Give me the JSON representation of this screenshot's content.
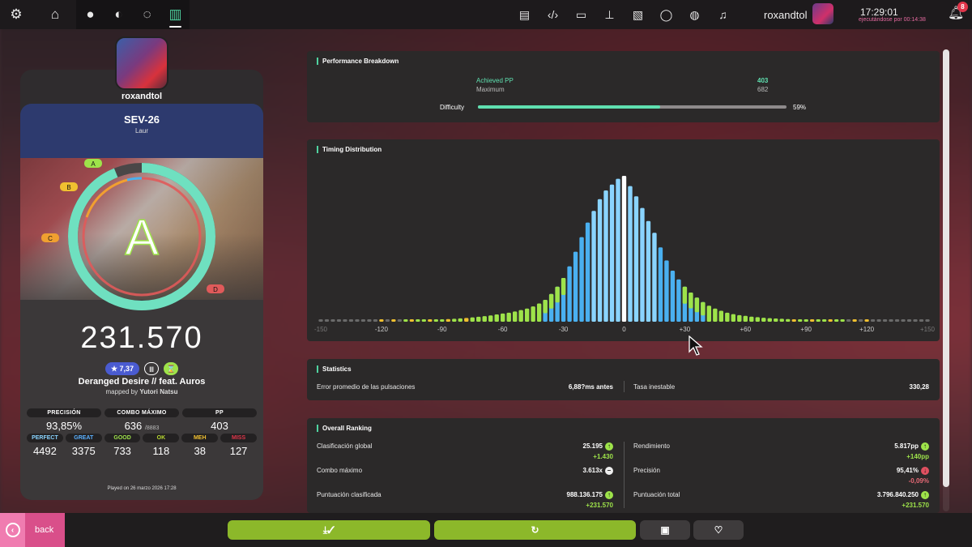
{
  "topbar": {
    "settings_icon": "gear-icon",
    "home_icon": "home-icon",
    "rulesets": [
      "osu-icon",
      "taiko-icon",
      "catch-icon",
      "mania-icon"
    ],
    "right_icons": [
      "news-icon",
      "code-icon",
      "wiki-icon",
      "hierarchy-icon",
      "changelog-icon",
      "chat-icon",
      "globe-icon",
      "music-icon"
    ],
    "username": "roxandtol",
    "time": "17:29:01",
    "runtime": "ejecutándose por 00:14:38",
    "notification_count": "8"
  },
  "player": {
    "username": "roxandtol"
  },
  "beatmap": {
    "difficulty": "SEV-26",
    "mapper": "Laur",
    "title": "Deranged Desire // feat. Auros",
    "mapped_by_prefix": "mapped by",
    "mapped_by": "Yutori Natsu",
    "star_rating": "★ 7,37"
  },
  "score": {
    "grade": "A",
    "total": "231.570",
    "rank_labels": {
      "a": "A",
      "b": "B",
      "c": "C",
      "d": "D"
    },
    "accuracy_fraction": 0.9385,
    "stats": [
      {
        "label": "PRECISIÓN",
        "value": "93,85%",
        "suffix": ""
      },
      {
        "label": "COMBO MÁXIMO",
        "value": "636",
        "suffix": "/8883"
      },
      {
        "label": "PP",
        "value": "403",
        "suffix": ""
      }
    ],
    "judgements": [
      {
        "label": "PERFECT",
        "value": "4492",
        "color": "#8ad4ff"
      },
      {
        "label": "GREAT",
        "value": "3375",
        "color": "#5ab0ff"
      },
      {
        "label": "GOOD",
        "value": "733",
        "color": "#9ee34a"
      },
      {
        "label": "OK",
        "value": "118",
        "color": "#b8d830"
      },
      {
        "label": "MEH",
        "value": "38",
        "color": "#f0c030"
      },
      {
        "label": "MISS",
        "value": "127",
        "color": "#e0354a"
      }
    ],
    "played_on": "Played on 26 marzo 2026 17:28"
  },
  "performance": {
    "title": "Performance Breakdown",
    "achieved_label": "Achieved PP",
    "achieved_value": "403",
    "maximum_label": "Maximum",
    "maximum_value": "682",
    "difficulty_label": "Difficulty",
    "difficulty_percent": "59%",
    "difficulty_fraction": 0.59
  },
  "timing": {
    "title": "Timing Distribution"
  },
  "chart_data": {
    "type": "bar",
    "xlabel": "",
    "ylabel": "",
    "xlim": [
      -150,
      150
    ],
    "ticks": [
      "-150",
      "-120",
      "-90",
      "-60",
      "-30",
      "0",
      "+30",
      "+60",
      "+90",
      "+120",
      "+150"
    ],
    "x": [
      -150,
      -147,
      -144,
      -141,
      -138,
      -135,
      -132,
      -129,
      -126,
      -123,
      -120,
      -117,
      -114,
      -111,
      -108,
      -105,
      -102,
      -99,
      -96,
      -93,
      -90,
      -87,
      -84,
      -81,
      -78,
      -75,
      -72,
      -69,
      -66,
      -63,
      -60,
      -57,
      -54,
      -51,
      -48,
      -45,
      -42,
      -39,
      -36,
      -33,
      -30,
      -27,
      -24,
      -21,
      -18,
      -15,
      -12,
      -9,
      -6,
      -3,
      0,
      3,
      6,
      9,
      12,
      15,
      18,
      21,
      24,
      27,
      30,
      33,
      36,
      39,
      42,
      45,
      48,
      51,
      54,
      57,
      60,
      63,
      66,
      69,
      72,
      75,
      78,
      81,
      84,
      87,
      90,
      93,
      96,
      99,
      102,
      105,
      108,
      111,
      114,
      117,
      120,
      123,
      126,
      129,
      132,
      135,
      138,
      141,
      144,
      147,
      150
    ],
    "values": [
      1,
      1,
      1,
      1,
      1,
      1,
      1,
      1,
      1,
      1,
      1,
      1,
      1,
      1,
      1,
      1.2,
      1.2,
      1.3,
      1.4,
      1.5,
      1.6,
      1.8,
      2,
      2.3,
      2.6,
      3,
      3.4,
      3.8,
      4.3,
      5,
      5.6,
      6.2,
      7,
      8,
      9,
      10.5,
      12.5,
      15,
      19,
      24,
      30,
      38,
      48,
      58,
      68,
      76,
      84,
      90,
      94,
      98,
      100,
      93,
      86,
      78,
      69,
      61,
      51,
      42,
      35,
      29,
      24,
      20,
      16.5,
      13.5,
      11,
      9,
      7.5,
      6.2,
      5.2,
      4.5,
      4,
      3.5,
      3.1,
      2.7,
      2.4,
      2.2,
      2,
      1.8,
      1.6,
      1.5,
      1.4,
      1.3,
      1.2,
      1.1,
      1,
      1,
      1,
      1,
      1,
      1,
      1,
      1,
      1,
      1,
      1,
      1,
      1,
      1,
      1,
      1,
      1
    ]
  },
  "statistics": {
    "title": "Statistics",
    "error_label": "Error promedio de las pulsaciones",
    "error_value": "6,88?ms antes",
    "ur_label": "Tasa inestable",
    "ur_value": "330,28"
  },
  "ranking": {
    "title": "Overall Ranking",
    "rows": [
      {
        "label": "Clasificación global",
        "value": "25.195",
        "delta": "+1.430",
        "dir": "up"
      },
      {
        "label": "Rendimiento",
        "value": "5.817pp",
        "delta": "+140pp",
        "dir": "up"
      },
      {
        "label": "Combo máximo",
        "value": "3.613x",
        "delta": "",
        "dir": "same"
      },
      {
        "label": "Precisión",
        "value": "95,41%",
        "delta": "-0,09%",
        "dir": "down"
      },
      {
        "label": "Puntuación clasificada",
        "value": "988.136.175",
        "delta": "+231.570",
        "dir": "up"
      },
      {
        "label": "Puntuación total",
        "value": "3.796.840.250",
        "delta": "+231.570",
        "dir": "up"
      }
    ]
  },
  "bottom": {
    "back_label": "back",
    "back_icon": "chevron-left-icon",
    "download_icon": "download-check-icon",
    "retry_icon": "retry-icon",
    "collection_icon": "collection-icon",
    "favourite_icon": "heart-icon"
  },
  "colors": {
    "accent_green": "#8cb82a",
    "teal": "#5fe0b0",
    "pink": "#d94f8a",
    "perfect_bar": "#8ad4ff",
    "great_bar": "#4ab0f0",
    "good_bar": "#9ee34a",
    "meh_bar": "#f0c030"
  }
}
